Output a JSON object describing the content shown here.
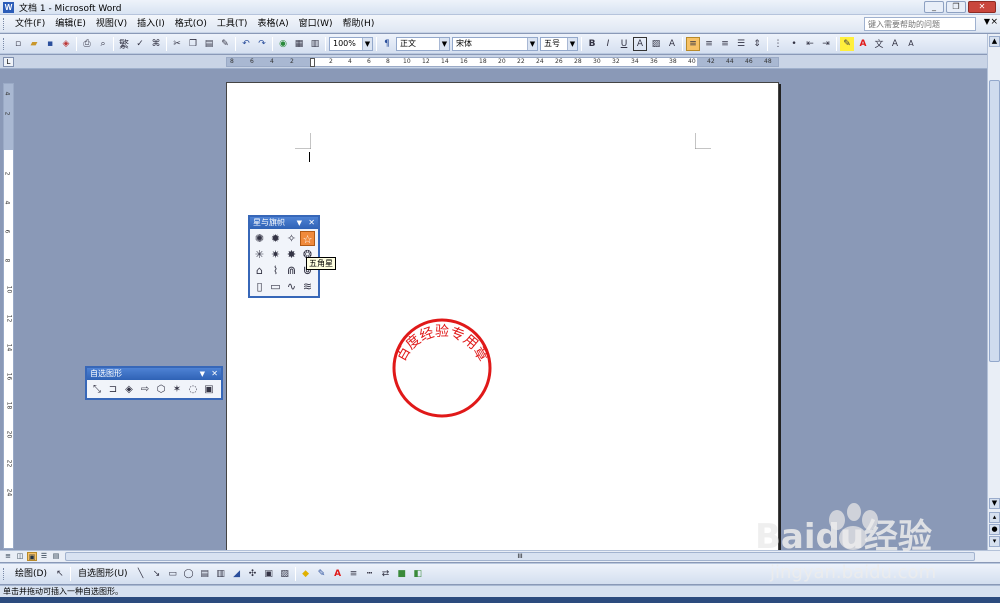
{
  "window": {
    "title": "文档 1 - Microsoft Word",
    "icon": "word-icon",
    "minimize": "_",
    "restore": "❐",
    "close": "✕"
  },
  "menu": {
    "items": [
      "文件(F)",
      "编辑(E)",
      "视图(V)",
      "插入(I)",
      "格式(O)",
      "工具(T)",
      "表格(A)",
      "窗口(W)",
      "帮助(H)"
    ],
    "help_placeholder": "键入需要帮助的问题",
    "help_close": "×"
  },
  "toolbar": {
    "zoom": "100%",
    "style": "正文",
    "font": "宋体",
    "size": "五号",
    "bold": "B",
    "italic": "I",
    "underline": "U",
    "char_border": "A",
    "char_scale": "A"
  },
  "ruler": {
    "corner": "L",
    "h_ticks": [
      "8",
      "6",
      "4",
      "2",
      "",
      "2",
      "4",
      "6",
      "8",
      "10",
      "12",
      "14",
      "16",
      "18",
      "20",
      "22",
      "24",
      "26",
      "28",
      "30",
      "32",
      "34",
      "36",
      "38",
      "40",
      "42",
      "44",
      "46",
      "48"
    ],
    "v_ticks": [
      "4",
      "2",
      "",
      "2",
      "4",
      "6",
      "8",
      "10",
      "12",
      "14",
      "16",
      "18",
      "20",
      "22",
      "24"
    ]
  },
  "stars_panel": {
    "title": "星与旗帜",
    "tooltip": "五角星"
  },
  "autoshape_panel": {
    "title": "自选图形"
  },
  "seal": {
    "text": "百度经验专用章",
    "color": "#e01919"
  },
  "drawbar": {
    "draw": "绘图(D)",
    "autoshapes": "自选图形(U)"
  },
  "hscroll": {
    "grip": "III"
  },
  "status": {
    "text": "单击并拖动可插入一种自选图形。"
  },
  "watermark": {
    "brand_logo": "Baidu经验",
    "url": "jingyan.baidu.com"
  },
  "colors": {
    "panel_border": "#3767b8",
    "active_button": "#f7c266",
    "hot_shape": "#f08a3c",
    "workspace": "#8a99b7"
  }
}
